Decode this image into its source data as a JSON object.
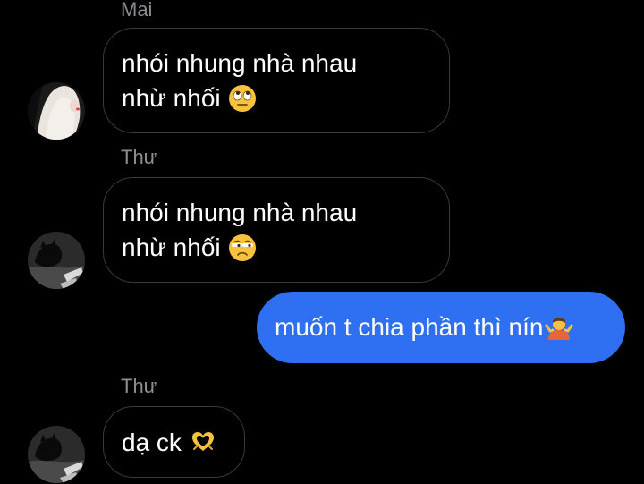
{
  "messages": [
    {
      "sender": "Mai",
      "line1": "nhói nhung nhà nhau",
      "line2": "nhừ nhối",
      "emoji": "face-with-rolling-eyes-emoji"
    },
    {
      "sender": "Thư",
      "line1": "nhói nhung nhà nhau",
      "line2": "nhừ nhối",
      "emoji": "unamused-face-emoji"
    },
    {
      "outgoing_text": "muốn t chia phần thì nín",
      "emoji": "person-shrugging-emoji"
    },
    {
      "sender": "Thư",
      "line1": "dạ ck",
      "emoji": "heart-hands-emoji"
    }
  ],
  "colors": {
    "background": "#000000",
    "incoming_border": "#3a3a3c",
    "outgoing_bubble": "#2f6ff1",
    "sender_name": "#8e8e93",
    "message_text": "#ffffff"
  }
}
